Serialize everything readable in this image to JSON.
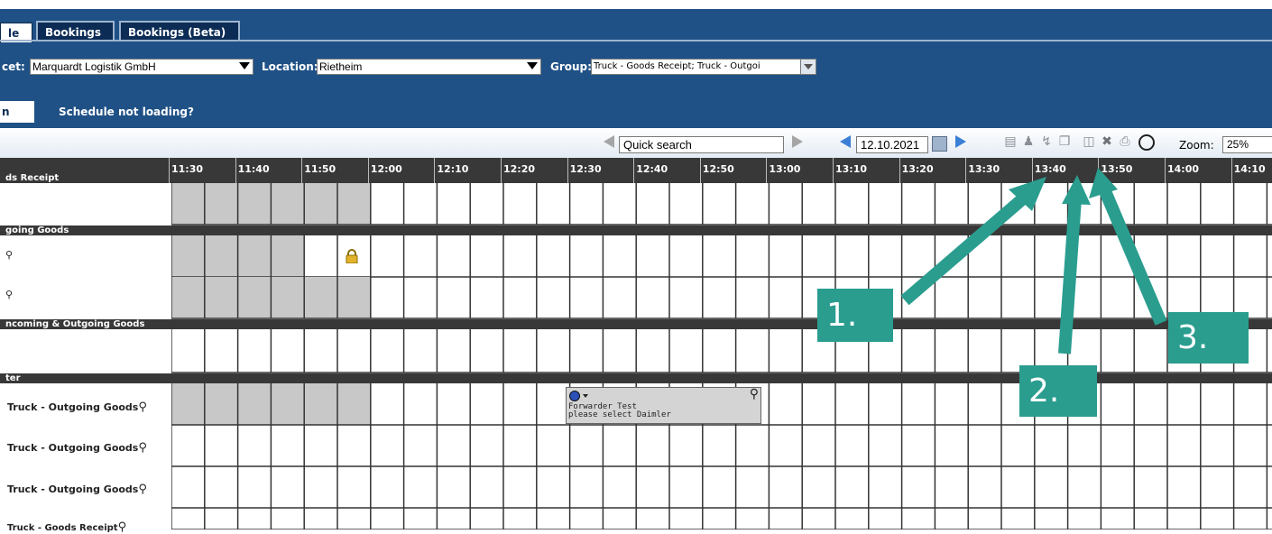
{
  "tabs": [
    {
      "label": "le"
    },
    {
      "label": "Bookings"
    },
    {
      "label": "Bookings (Beta)"
    }
  ],
  "filters": {
    "market_label": "cet:",
    "market_value": "Marquardt Logistik GmbH",
    "location_label": "Location:",
    "location_value": "Rietheim",
    "group_label": "Group:",
    "group_value": "Truck - Goods Receipt; Truck - Outgoi"
  },
  "subtabs": [
    {
      "label": "n"
    },
    {
      "label": "Schedule not loading?"
    }
  ],
  "toolbar": {
    "quick_search": "Quick search",
    "date": "12.10.2021",
    "zoom_label": "Zoom:",
    "zoom_value": "25%"
  },
  "time_slots": [
    "11:30",
    "11:40",
    "11:50",
    "12:00",
    "12:10",
    "12:20",
    "12:30",
    "12:40",
    "12:50",
    "13:00",
    "13:10",
    "13:20",
    "13:30",
    "13:40",
    "13:50",
    "14:00",
    "14:10"
  ],
  "sections": [
    {
      "label": "ds Receipt"
    },
    {
      "label": "going Goods"
    },
    {
      "label": "ncoming & Outgoing Goods"
    },
    {
      "label": "ter"
    }
  ],
  "rows": [
    {
      "label": ""
    },
    {
      "label": ""
    },
    {
      "label": ""
    },
    {
      "label": ""
    },
    {
      "label": "Truck - Outgoing Goods"
    },
    {
      "label": "Truck - Outgoing Goods"
    },
    {
      "label": "Truck - Outgoing Goods"
    },
    {
      "label": "Truck - Goods Receipt"
    }
  ],
  "booking": {
    "line1": "Forwarder Test",
    "line2": "please select Daimler"
  },
  "annotations": [
    {
      "label": "1."
    },
    {
      "label": "2."
    },
    {
      "label": "3."
    }
  ],
  "colors": {
    "header": "#1f5186",
    "annotation": "#2a9d8f",
    "grid_shade": "#c8c8c8"
  }
}
